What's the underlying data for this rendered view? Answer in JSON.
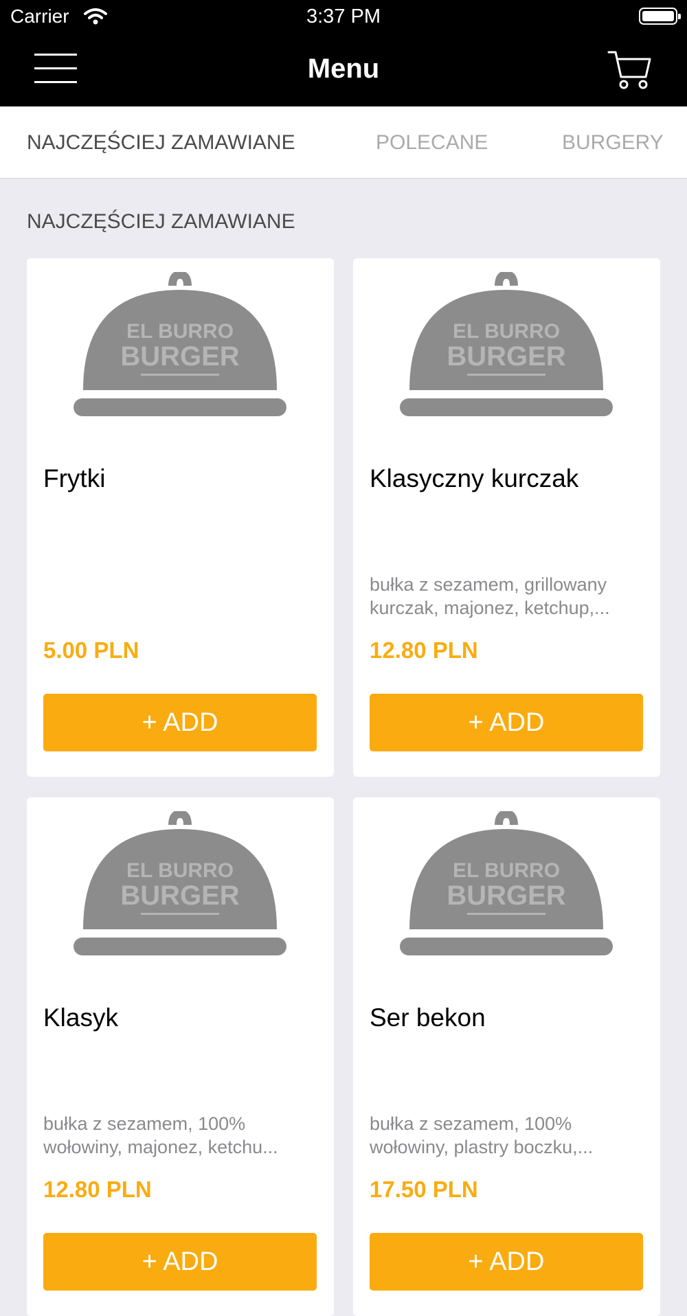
{
  "status_bar": {
    "carrier": "Carrier",
    "time": "3:37 PM"
  },
  "navbar": {
    "title": "Menu",
    "menu_icon": "hamburger-icon",
    "cart_icon": "cart-icon"
  },
  "tabs": [
    {
      "label": "NAJCZĘŚCIEJ ZAMAWIANE",
      "active": true
    },
    {
      "label": "POLECANE",
      "active": false
    },
    {
      "label": "BURGERY",
      "active": false
    }
  ],
  "section_title": "NAJCZĘŚCIEJ ZAMAWIANE",
  "placeholder_logo": {
    "line1": "EL BURRO",
    "line2": "BURGER"
  },
  "items": [
    {
      "name": "Frytki",
      "desc_line1": "",
      "desc_line2": "",
      "price": "5.00 PLN",
      "add_label": "+ ADD"
    },
    {
      "name": "Klasyczny kurczak",
      "desc_line1": "bułka z sezamem, grillowany",
      "desc_line2": "kurczak, majonez, ketchup,...",
      "price": "12.80 PLN",
      "add_label": "+ ADD"
    },
    {
      "name": "Klasyk",
      "desc_line1": "bułka z sezamem, 100%",
      "desc_line2": "wołowiny, majonez, ketchu...",
      "price": "12.80 PLN",
      "add_label": "+ ADD"
    },
    {
      "name": "Ser bekon",
      "desc_line1": "bułka z sezamem, 100%",
      "desc_line2": "wołowiny, plastry boczku,...",
      "price": "17.50 PLN",
      "add_label": "+ ADD"
    }
  ],
  "colors": {
    "accent": "#faab0f",
    "price": "#f9ac11",
    "background": "#ecebf1",
    "bar": "#000000"
  }
}
